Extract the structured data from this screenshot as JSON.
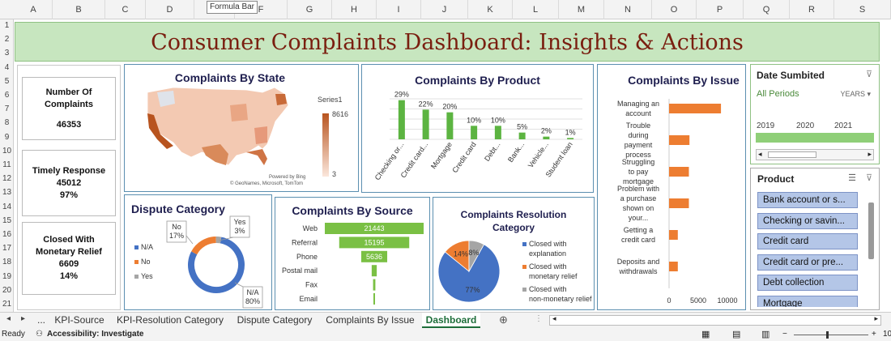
{
  "tooltip": "Formula Bar",
  "columns": [
    "A",
    "B",
    "C",
    "D",
    "E",
    "F",
    "G",
    "H",
    "I",
    "J",
    "K",
    "L",
    "M",
    "N",
    "O",
    "P",
    "Q",
    "R",
    "S"
  ],
  "rows": [
    "1",
    "2",
    "3",
    "4",
    "5",
    "6",
    "7",
    "8",
    "9",
    "10",
    "11",
    "12",
    "13",
    "14",
    "15",
    "16",
    "17",
    "18",
    "19",
    "20",
    "21"
  ],
  "title": "Consumer Complaints Dashboard: Insights & Actions",
  "kpis": [
    {
      "label": "Number Of Complaints",
      "value": "46353",
      "extra": ""
    },
    {
      "label": "Timely Response",
      "value": "45012",
      "extra": "97%"
    },
    {
      "label": "Closed With Monetary Relief",
      "value": "6609",
      "extra": "14%"
    }
  ],
  "state": {
    "title": "Complaints By State",
    "legend_name": "Series1",
    "max": "8616",
    "min": "3",
    "credit1": "Powered by Bing",
    "credit2": "© GeoNames, Microsoft, TomTom"
  },
  "chart_data": [
    {
      "type": "bar",
      "title": "Complaints By Product",
      "categories": [
        "Checking or...",
        "Credit card...",
        "Mortgage",
        "Credit card",
        "Debt...",
        "Bank...",
        "Vehicle...",
        "Student loan"
      ],
      "values": [
        29,
        22,
        20,
        10,
        10,
        5,
        2,
        1
      ],
      "labels": [
        "29%",
        "22%",
        "20%",
        "10%",
        "10%",
        "5%",
        "2%",
        "1%"
      ],
      "color": "#5cb441"
    },
    {
      "type": "bar",
      "title": "Complaints By Issue",
      "categories": [
        "Managing an account",
        "Trouble during payment process",
        "Struggling to pay mortgage",
        "Problem with a purchase shown on your...",
        "Getting a credit card",
        "Deposits and withdrawals"
      ],
      "values": [
        8900,
        3500,
        3400,
        3400,
        1500,
        1500
      ],
      "xticks": [
        "0",
        "5000",
        "10000"
      ],
      "xlim": [
        0,
        10000
      ],
      "color": "#ed7d31"
    },
    {
      "type": "pie",
      "title": "Dispute Category",
      "slices": [
        {
          "name": "N/A",
          "value": 80,
          "label": "N/A\n80%",
          "color": "#4472c4"
        },
        {
          "name": "No",
          "value": 17,
          "label": "No\n17%",
          "color": "#ed7d31"
        },
        {
          "name": "Yes",
          "value": 3,
          "label": "Yes\n3%",
          "color": "#a5a5a5"
        }
      ]
    },
    {
      "type": "bar",
      "title": "Complaints By Source",
      "categories": [
        "Web",
        "Referral",
        "Phone",
        "Postal mail",
        "Fax",
        "Email"
      ],
      "values": [
        21443,
        15195,
        5636,
        1100,
        500,
        100
      ],
      "labels": [
        "21443",
        "15195",
        "5636",
        "",
        "",
        ""
      ],
      "color": "#7ac044"
    },
    {
      "type": "pie",
      "title": "Complaints Resolution Category",
      "slices": [
        {
          "name": "Closed with explanation",
          "value": 77,
          "label": "77%",
          "color": "#4472c4"
        },
        {
          "name": "Closed with monetary relief",
          "value": 14,
          "label": "14%",
          "color": "#ed7d31"
        },
        {
          "name": "Closed with non-monetary relief",
          "value": 8,
          "label": "8%",
          "color": "#a5a5a5"
        }
      ]
    }
  ],
  "date_slicer": {
    "title": "Date Sumbited",
    "all": "All Periods",
    "unit": "YEARS",
    "years": [
      "2019",
      "2020",
      "2021"
    ]
  },
  "product_slicer": {
    "title": "Product",
    "items": [
      "Bank account or s...",
      "Checking or savin...",
      "Credit card",
      "Credit card or pre...",
      "Debt collection",
      "Mortgage"
    ]
  },
  "tabs": {
    "more": "...",
    "items": [
      "KPI-Source",
      "KPI-Resolution Category",
      "Dispute Category",
      "Complaints By Issue",
      "Dashboard"
    ],
    "active": "Dashboard"
  },
  "status": {
    "ready": "Ready",
    "accessibility": "Accessibility: Investigate",
    "zoom": "10"
  }
}
